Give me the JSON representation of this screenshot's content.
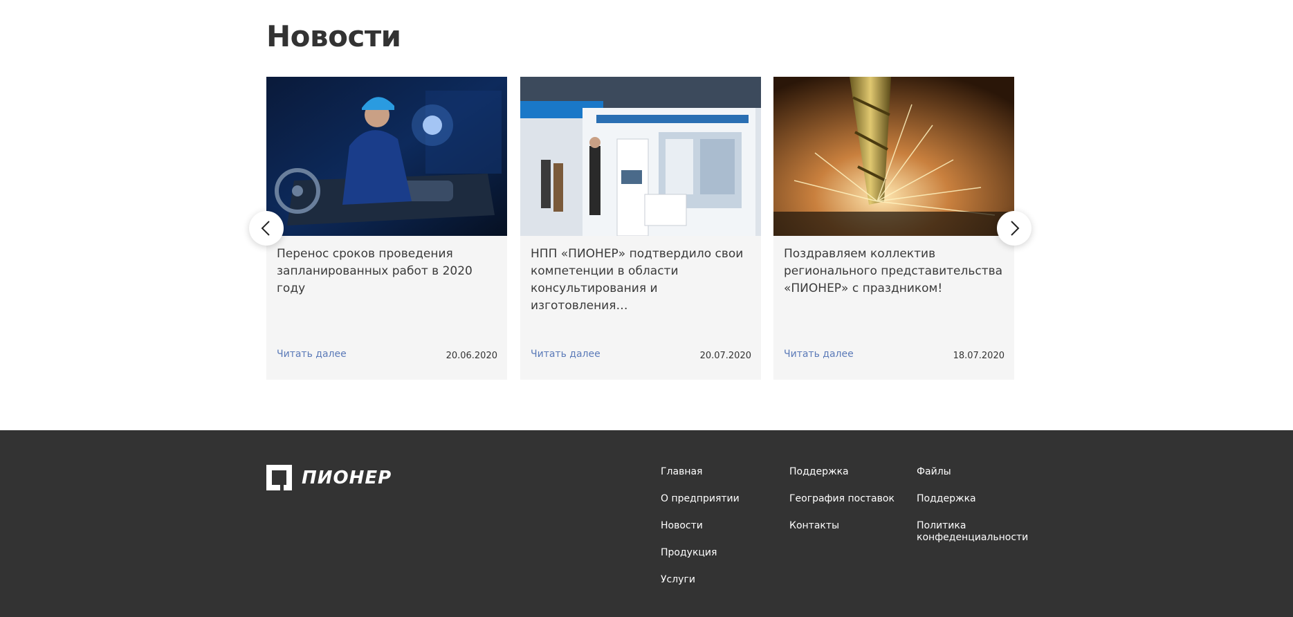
{
  "news": {
    "title": "Новости",
    "cards": [
      {
        "text": "Перенос сроков проведения запланированных работ в 2020 году",
        "link": "Читать далее",
        "date": "20.06.2020"
      },
      {
        "text": "НПП «ПИОНЕР» подтвердило свои компетенции в области консультирования и изготовления…",
        "link": "Читать далее",
        "date": "20.07.2020"
      },
      {
        "text": "Поздравляем коллектив регионального представительства «ПИОНЕР» с праздником!",
        "link": "Читать далее",
        "date": "18.07.2020"
      }
    ]
  },
  "footer": {
    "logo_text": "ПИОНЕР",
    "col1": [
      "Главная",
      "О предприятии",
      "Новости",
      "Продукция",
      "Услуги"
    ],
    "col2": [
      "Поддержка",
      "География поставок",
      "Контакты"
    ],
    "col3": [
      "Файлы",
      "Поддержка",
      "Политика конфеденциальности"
    ]
  },
  "colors": {
    "footer_bg": "#333333",
    "link": "#5b7ab8",
    "card_bg": "#f5f5f5"
  },
  "icons": {
    "prev": "chevron-left-icon",
    "next": "chevron-right-icon"
  }
}
